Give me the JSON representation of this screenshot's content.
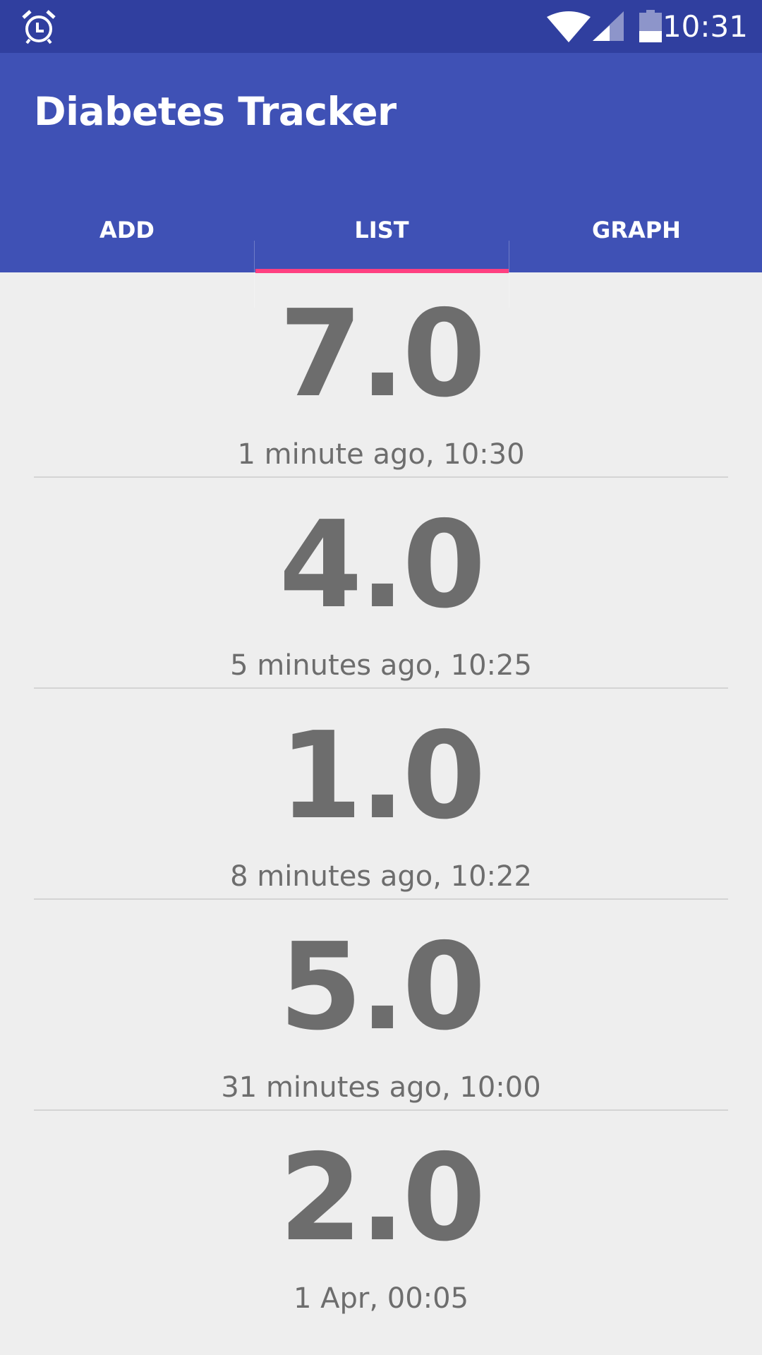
{
  "status_bar": {
    "time": "10:31",
    "icons": [
      "alarm-icon",
      "wifi-icon",
      "cell-signal-icon",
      "battery-icon"
    ]
  },
  "app": {
    "title": "Diabetes Tracker",
    "colors": {
      "primary": "#3f51b5",
      "primary_dark": "#303f9f",
      "accent": "#ff4081",
      "text_value": "#6d6d6d",
      "background": "#eeeeee"
    }
  },
  "tabs": [
    {
      "label": "ADD",
      "selected": false
    },
    {
      "label": "LIST",
      "selected": true
    },
    {
      "label": "GRAPH",
      "selected": false
    }
  ],
  "entries": [
    {
      "value": "7.0",
      "time": "1 minute ago, 10:30"
    },
    {
      "value": "4.0",
      "time": "5 minutes ago, 10:25"
    },
    {
      "value": "1.0",
      "time": "8 minutes ago, 10:22"
    },
    {
      "value": "5.0",
      "time": "31 minutes ago, 10:00"
    },
    {
      "value": "2.0",
      "time": "1 Apr, 00:05"
    }
  ]
}
